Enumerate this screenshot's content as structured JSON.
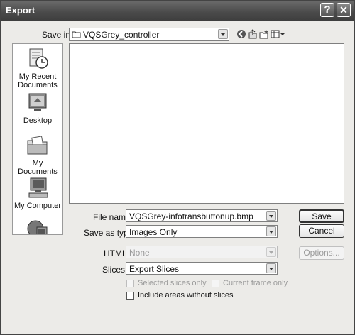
{
  "window": {
    "title": "Export"
  },
  "titlebar": {
    "help_glyph": "?",
    "close_glyph": "✕"
  },
  "save_in": {
    "label": "Save in:",
    "value": "VQSGrey_controller"
  },
  "places": [
    {
      "label_line1": "My Recent",
      "label_line2": "Documents",
      "icon": "recent-documents-icon"
    },
    {
      "label_line1": "Desktop",
      "label_line2": "",
      "icon": "desktop-icon"
    },
    {
      "label_line1": "My Documents",
      "label_line2": "",
      "icon": "my-documents-icon"
    },
    {
      "label_line1": "My Computer",
      "label_line2": "",
      "icon": "my-computer-icon"
    },
    {
      "label_line1": "",
      "label_line2": "",
      "icon": "network-places-icon"
    }
  ],
  "file_name": {
    "label": "File name:",
    "value": "VQSGrey-infotransbuttonup.bmp"
  },
  "save_as_type": {
    "label": "Save as type:",
    "value": "Images Only"
  },
  "html": {
    "label": "HTML:",
    "value": "None"
  },
  "slices": {
    "label": "Slices:",
    "value": "Export Slices"
  },
  "buttons": {
    "save": "Save",
    "cancel": "Cancel",
    "options": "Options..."
  },
  "checkboxes": {
    "selected_slices_only": "Selected slices only",
    "current_frame_only": "Current frame only",
    "include_areas_without_slices": "Include areas without slices"
  },
  "colors": {
    "titlebar": "#4a4a4a",
    "dialog_bg": "#ecebe8",
    "disabled_text": "#9a9a9a"
  }
}
